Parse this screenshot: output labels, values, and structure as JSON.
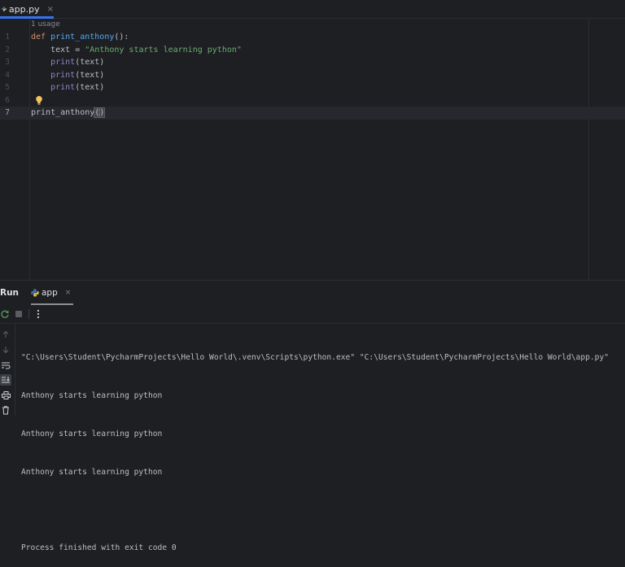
{
  "tab": {
    "filename": "app.py",
    "close": "×"
  },
  "editor": {
    "usage_hint": "1 usage",
    "line_numbers": [
      "1",
      "2",
      "3",
      "4",
      "5",
      "6",
      "7"
    ],
    "lines": {
      "l1": {
        "kw": "def",
        "fn": "print_anthony",
        "rest": "():"
      },
      "l2": {
        "indent": "    ",
        "var": "text = ",
        "str": "\"Anthony starts learning python\""
      },
      "l3": {
        "indent": "    ",
        "builtin": "print",
        "rest": "(text)"
      },
      "l4": {
        "indent": "    ",
        "builtin": "print",
        "rest": "(text)"
      },
      "l5": {
        "indent": "    ",
        "builtin": "print",
        "rest": "(text)"
      },
      "l7": {
        "call": "print_anthony",
        "open": "(",
        "close": ")"
      }
    }
  },
  "run": {
    "title": "Run",
    "tab_label": "app",
    "tab_close": "×",
    "console": [
      "\"C:\\Users\\Student\\PycharmProjects\\Hello World\\.venv\\Scripts\\python.exe\" \"C:\\Users\\Student\\PycharmProjects\\Hello World\\app.py\"",
      "Anthony starts learning python",
      "Anthony starts learning python",
      "Anthony starts learning python",
      "",
      "Process finished with exit code 0"
    ]
  },
  "colors": {
    "background": "#1e1f22",
    "accent": "#3574f0",
    "keyword": "#cf8e6d",
    "function": "#56a8f5",
    "string": "#6aab73",
    "builtin": "#8888c6"
  },
  "icons": {
    "file_tab": "python-file-icon",
    "run_tab": "python-file-icon",
    "gutter": "lightbulb-icon",
    "toolbar": [
      "rerun-icon",
      "stop-icon",
      "more-options-icon"
    ],
    "side": [
      "scroll-up-icon",
      "scroll-down-icon",
      "soft-wrap-icon",
      "scroll-to-end-icon",
      "print-icon",
      "clear-all-icon"
    ]
  }
}
